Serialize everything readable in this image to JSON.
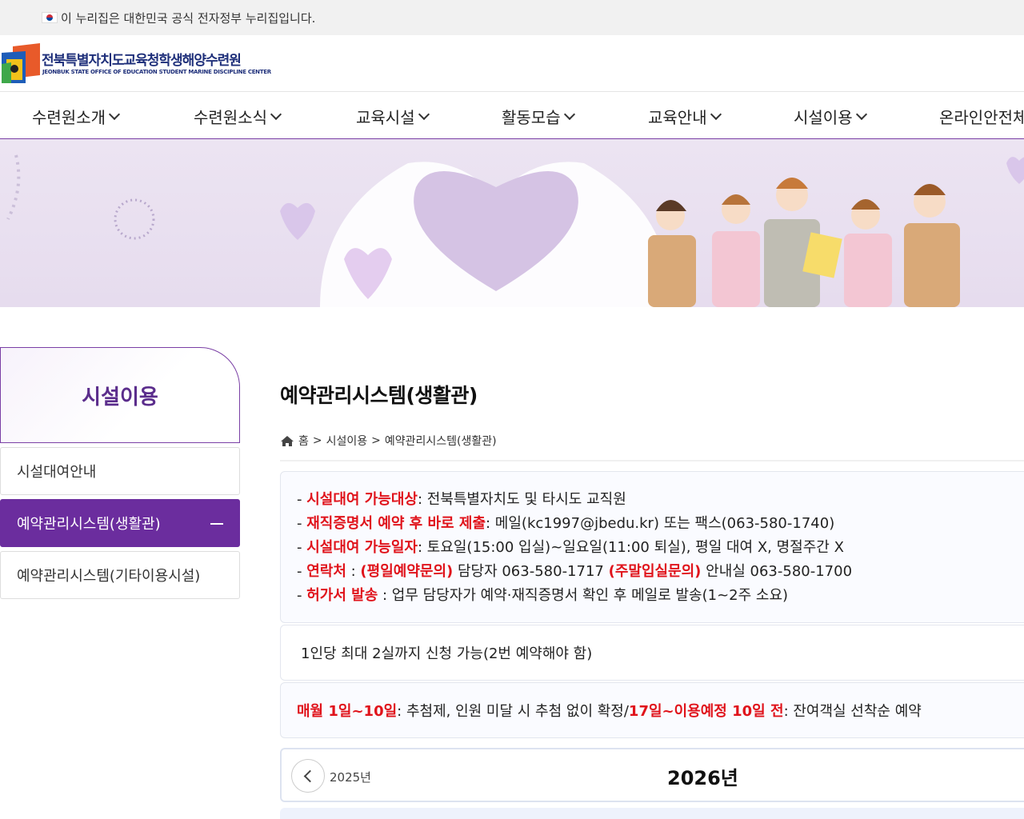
{
  "gov_banner": {
    "text": "이 누리집은 대한민국 공식 전자정부 누리집입니다."
  },
  "logo": {
    "name_ko": "전북특별자치도교육청학생해양수련원",
    "name_en": "JEONBUK STATE OFFICE OF EDUCATION STUDENT MARINE DISCIPLINE CENTER"
  },
  "gnb": [
    "수련원소개",
    "수련원소식",
    "교육시설",
    "활동모습",
    "교육안내",
    "시설이용",
    "온라인안전체험"
  ],
  "sidebar": {
    "title": "시설이용",
    "items": [
      "시설대여안내",
      "예약관리시스템(생활관)",
      "예약관리시스템(기타이용시설)"
    ]
  },
  "page_title": "예약관리시스템(생활관)",
  "breadcrumb": {
    "home": "홈",
    "sep": ">",
    "level1": "시설이용",
    "level2": "예약관리시스템(생활관)"
  },
  "notice": {
    "l1_red": "시설대여 가능대상",
    "l1_text": ": 전북특별자치도 및 타시도 교직원",
    "l2_red": "재직증명서 예약 후 바로 제출",
    "l2_text": ": 메일(kc1997@jbedu.kr) 또는 팩스(063-580-1740)",
    "l3_red": "시설대여 가능일자",
    "l3_text": ": 토요일(15:00 입실)~일요일(11:00 퇴실), 평일 대여 X, 명절주간 X",
    "l4_red": "연락처",
    "l4_sep": " : ",
    "l4_red2": "(평일예약문의)",
    "l4_text": " 담당자 063-580-1717 ",
    "l4_red3": "(주말입실문의)",
    "l4_text2": " 안내실 063-580-1700",
    "l5_red": "허가서 발송",
    "l5_text": " : 업무 담당자가 예약·재직증명서 확인 후 메일로 발송(1~2주 소요)"
  },
  "notice2": "1인당 최대 2실까지 신청 가능(2번 예약해야 함)",
  "notice3": {
    "red1": "매월 1일~10일",
    "text1": ": 추첨제, 인원 미달 시 추첨 없이 확정/ ",
    "red2": "17일~이용예정 10일 전",
    "text2": ": 잔여객실 선착순 예약"
  },
  "year_nav": {
    "prev": "2025년",
    "current": "2026년"
  }
}
